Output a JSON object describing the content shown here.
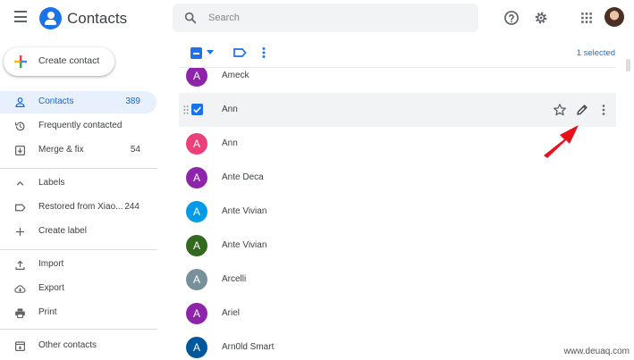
{
  "header": {
    "app_title": "Contacts",
    "search_placeholder": "Search",
    "icons": [
      "menu-icon",
      "help-icon",
      "settings-icon",
      "apps-grid-icon"
    ]
  },
  "sidebar": {
    "create_label": "Create contact",
    "items": [
      {
        "label": "Contacts",
        "count": "389",
        "icon": "person-icon",
        "active": true
      },
      {
        "label": "Frequently contacted",
        "count": "",
        "icon": "history-icon"
      },
      {
        "label": "Merge & fix",
        "count": "54",
        "icon": "merge-icon"
      },
      {
        "label": "Labels",
        "count": "",
        "icon": "chevron-up-icon"
      },
      {
        "label": "Restored from Xiao...",
        "count": "244",
        "icon": "label-icon"
      },
      {
        "label": "Create label",
        "count": "",
        "icon": "plus-icon"
      },
      {
        "label": "Import",
        "count": "",
        "icon": "upload-icon"
      },
      {
        "label": "Export",
        "count": "",
        "icon": "cloud-download-icon"
      },
      {
        "label": "Print",
        "count": "",
        "icon": "printer-icon"
      },
      {
        "label": "Other contacts",
        "count": "",
        "icon": "other-contacts-icon"
      }
    ]
  },
  "toolbar": {
    "selected_text": "1 selected"
  },
  "contacts": [
    {
      "initial": "A",
      "name": "Ameck",
      "color": "#8e24aa"
    },
    {
      "initial": "A",
      "name": "Ann",
      "color": "#8e24aa",
      "selected": true
    },
    {
      "initial": "A",
      "name": "Ann",
      "color": "#ec407a"
    },
    {
      "initial": "A",
      "name": "Ante Deca",
      "color": "#8e24aa"
    },
    {
      "initial": "A",
      "name": "Ante Vivian",
      "color": "#039be5"
    },
    {
      "initial": "A",
      "name": "Ante Vivian",
      "color": "#33691e"
    },
    {
      "initial": "A",
      "name": "Arcelli",
      "color": "#78909c"
    },
    {
      "initial": "A",
      "name": "Ariel",
      "color": "#8e24aa"
    },
    {
      "initial": "A",
      "name": "Arn0ld Smart",
      "color": "#01579b"
    }
  ],
  "colors": {
    "accent": "#1a73e8",
    "annotation_arrow": "#e8101a"
  },
  "watermark": "www.deuaq.com"
}
